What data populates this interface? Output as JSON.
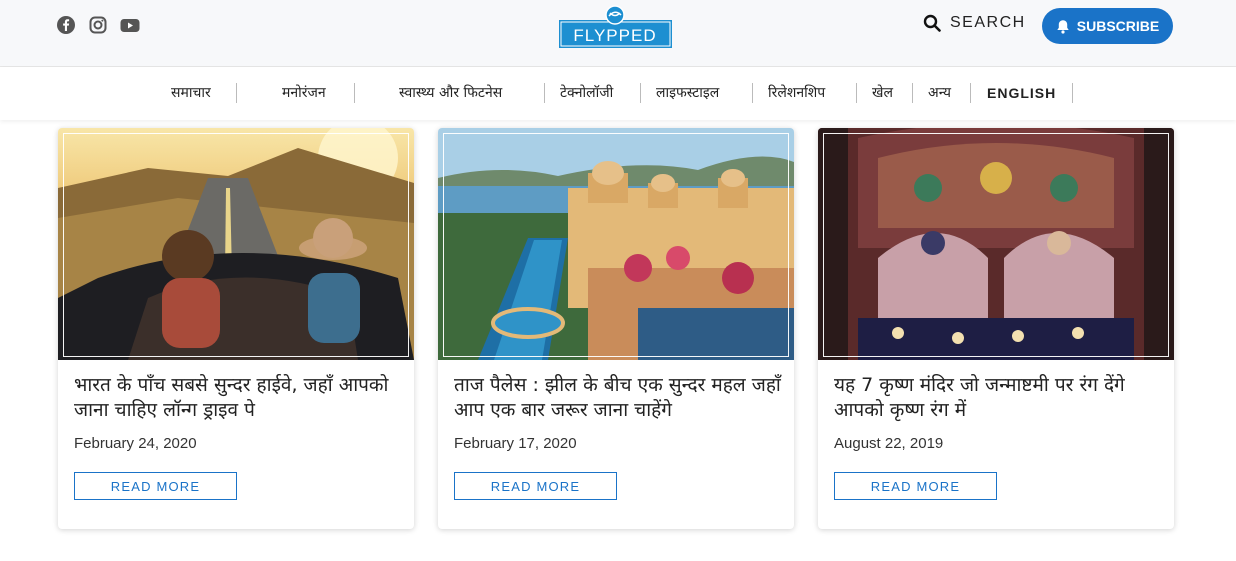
{
  "header": {
    "logo_text": "FLYPPED",
    "search_label": "SEARCH",
    "subscribe_label": "SUBSCRIBE",
    "social_icons": [
      "facebook-icon",
      "instagram-icon",
      "youtube-icon"
    ]
  },
  "nav": {
    "items": [
      {
        "label": "समाचार"
      },
      {
        "label": "मनोरंजन"
      },
      {
        "label": "स्वास्थ्य और फिटनेस"
      },
      {
        "label": "टेक्नोलॉजी"
      },
      {
        "label": "लाइफस्टाइल"
      },
      {
        "label": "रिलेशनशिप"
      },
      {
        "label": "खेल"
      },
      {
        "label": "अन्य"
      },
      {
        "label": "ENGLISH"
      }
    ]
  },
  "cards": [
    {
      "title": "भारत के पाँच सबसे सुन्दर हाईवे, जहाँ आपको जाना चाहिए लॉन्ग ड्राइव पे",
      "date": "February 24, 2020",
      "read_more": "READ MORE"
    },
    {
      "title": "ताज पैलेस : झील के बीच एक सुन्दर महल जहाँ आप एक बार जरूर जाना चाहेंगे",
      "date": "February 17, 2020",
      "read_more": "READ MORE"
    },
    {
      "title": "यह 7 कृष्ण मंदिर जो जन्माष्टमी पर रंग देंगे आपको कृष्ण रंग में",
      "date": "August 22, 2019",
      "read_more": "READ MORE"
    }
  ],
  "colors": {
    "accent": "#1a73c8",
    "logo": "#1d8fd1"
  }
}
